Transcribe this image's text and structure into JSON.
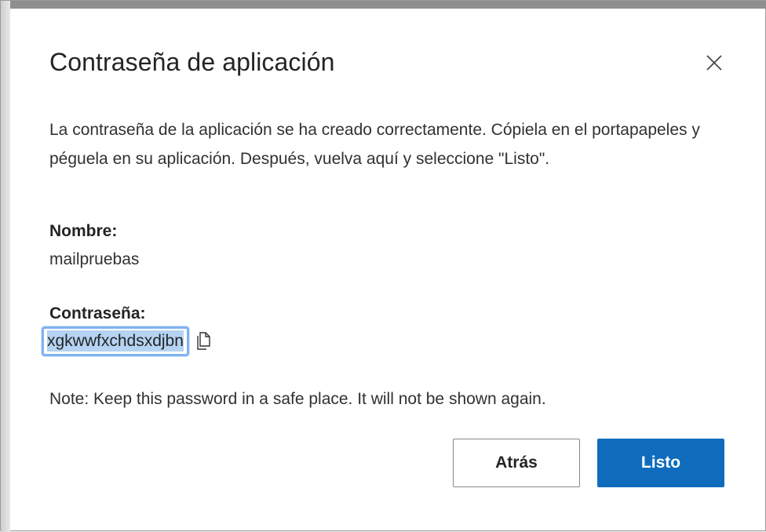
{
  "dialog": {
    "title": "Contraseña de aplicación",
    "close_icon": "close-icon",
    "description": "La contraseña de la aplicación se ha creado correctamente. Cópiela en el portapapeles y péguela en su aplicación. Después, vuelva aquí y seleccione \"Listo\".",
    "name_label": "Nombre:",
    "name_value": "mailpruebas",
    "password_label": "Contraseña:",
    "password_value": "xgkwwfxchdsxdjbn",
    "copy_icon": "copy-icon",
    "note": "Note: Keep this password in a safe place. It will not be shown again.",
    "back_label": "Atrás",
    "done_label": "Listo"
  },
  "colors": {
    "primary": "#0f6cbd",
    "selection": "#b5d3f3",
    "focus_ring": "#7fb3ee"
  }
}
